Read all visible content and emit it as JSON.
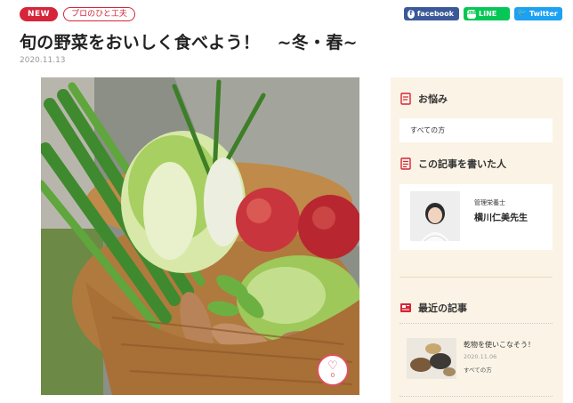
{
  "header": {
    "badge_new": "NEW",
    "badge_category": "プロのひと工夫",
    "title": "旬の野菜をおいしく食べよう！　~冬・春~",
    "date": "2020.11.13"
  },
  "share": {
    "facebook_label": "facebook",
    "line_label": "LINE",
    "twitter_label": "Twitter",
    "facebook_icon": "f",
    "line_icon": "LINE",
    "twitter_icon": "🐦"
  },
  "hero": {
    "like_icon": "♡",
    "like_count": "0"
  },
  "sidebar": {
    "worries": {
      "title": "お悩み",
      "audience": "すべての方"
    },
    "author": {
      "title": "この記事を書いた人",
      "role": "管理栄養士",
      "name": "横川仁美先生"
    },
    "recent": {
      "title": "最近の記事",
      "items": [
        {
          "title": "乾物を使いこなそう！",
          "date": "2020.11.06",
          "tag": "すべての方"
        }
      ]
    }
  },
  "colors": {
    "brand_red": "#d6253a",
    "facebook": "#3b5998",
    "line": "#06c755",
    "twitter": "#1da1f2",
    "sidebar_bg": "#fbf4e6"
  },
  "icons": {
    "worries": "memo-icon",
    "author": "document-icon",
    "recent": "news-icon",
    "like": "heart-icon"
  }
}
